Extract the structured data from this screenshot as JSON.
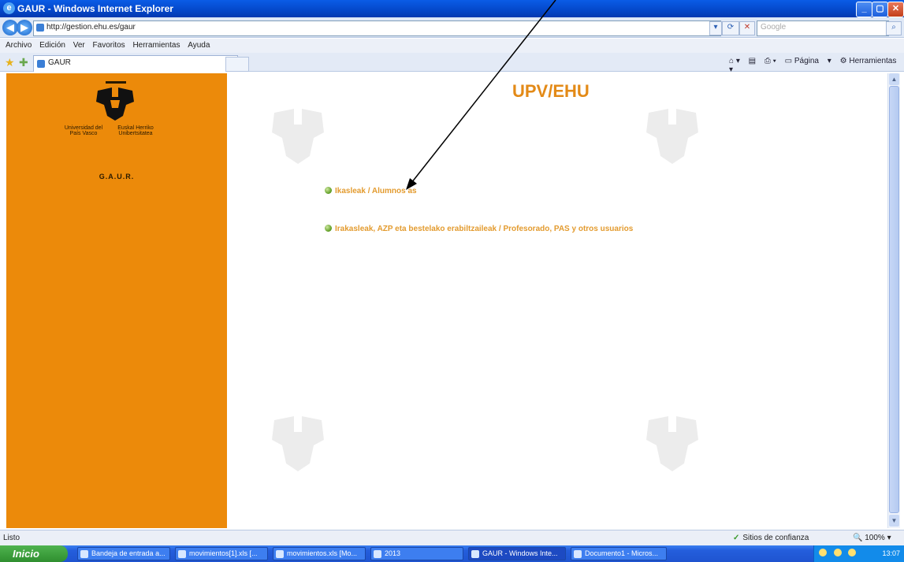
{
  "window": {
    "title": "GAUR - Windows Internet Explorer"
  },
  "address_bar": {
    "url": "http://gestion.ehu.es/gaur",
    "search_placeholder": "Google"
  },
  "menu": [
    "Archivo",
    "Edición",
    "Ver",
    "Favoritos",
    "Herramientas",
    "Ayuda"
  ],
  "tab": {
    "label": "GAUR"
  },
  "command_bar": {
    "pagina": "Página",
    "herramientas": "Herramientas"
  },
  "sidebar": {
    "university_left": "Universidad del País Vasco",
    "university_right": "Euskal Herriko Unibertsitatea",
    "gaur": "G.A.U.R."
  },
  "main": {
    "heading": "UPV/EHU",
    "links": [
      {
        "label": "Ikasleak / Alumnos as"
      },
      {
        "label": "Irakasleak, AZP eta bestelako erabiltzaileak / Profesorado, PAS y otros usuarios"
      }
    ]
  },
  "status": {
    "left": "Listo",
    "zone": "Sitios de confianza",
    "zoom": "100%"
  },
  "taskbar": {
    "start": "Inicio",
    "tasks": [
      {
        "label": "Bandeja de entrada a..."
      },
      {
        "label": "movimientos[1].xls [..."
      },
      {
        "label": "movimientos.xls [Mo..."
      },
      {
        "label": "2013"
      },
      {
        "label": "GAUR - Windows Inte..."
      },
      {
        "label": "Documento1 - Micros..."
      }
    ],
    "clock": "13:07"
  },
  "colors": {
    "sidebar": "#ec8a0a",
    "heading": "#e38a17",
    "link": "#e39b2f"
  }
}
